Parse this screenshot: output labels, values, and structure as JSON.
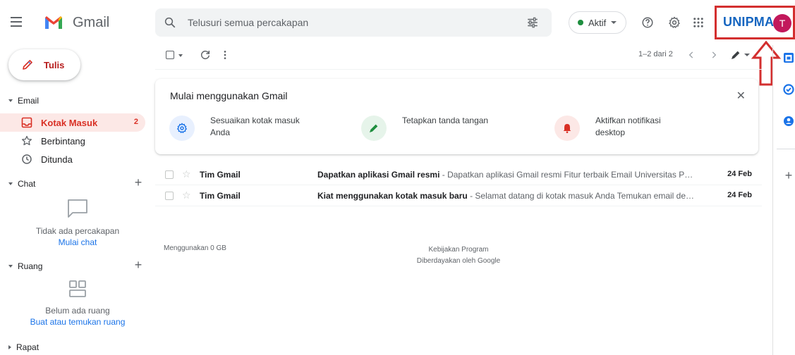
{
  "header": {
    "app_name": "Gmail",
    "search_placeholder": "Telusuri semua percakapan",
    "status_label": "Aktif",
    "brand_name": "UNIPMA",
    "avatar_initial": "T"
  },
  "compose": {
    "label": "Tulis"
  },
  "sidebar": {
    "email_section": "Email",
    "items": [
      {
        "label": "Kotak Masuk",
        "count": "2",
        "icon": "inbox-icon"
      },
      {
        "label": "Berbintang",
        "count": "",
        "icon": "star-icon"
      },
      {
        "label": "Ditunda",
        "count": "",
        "icon": "clock-icon"
      }
    ],
    "chat_section": "Chat",
    "chat_empty": "Tidak ada percakapan",
    "chat_link": "Mulai chat",
    "rooms_section": "Ruang",
    "rooms_empty": "Belum ada ruang",
    "rooms_link": "Buat atau temukan ruang",
    "meet_section": "Rapat"
  },
  "toolbar": {
    "pager": "1–2 dari 2"
  },
  "onboarding": {
    "title": "Mulai menggunakan Gmail",
    "items": [
      {
        "label": "Sesuaikan kotak masuk Anda",
        "icon": "gear-icon"
      },
      {
        "label": "Tetapkan tanda tangan",
        "icon": "pen-icon"
      },
      {
        "label": "Aktifkan notifikasi desktop",
        "icon": "bell-icon"
      }
    ]
  },
  "emails": [
    {
      "sender": "Tim Gmail",
      "subject": "Dapatkan aplikasi Gmail resmi",
      "snippet": " - Dapatkan aplikasi Gmail resmi Fitur terbaik Email Universitas PGRI ...",
      "date": "24 Feb"
    },
    {
      "sender": "Tim Gmail",
      "subject": "Kiat menggunakan kotak masuk baru",
      "snippet": " - Selamat datang di kotak masuk Anda Temukan email dengan...",
      "date": "24 Feb"
    }
  ],
  "footer": {
    "storage": "Menggunakan 0 GB",
    "policy": "Kebijakan Program",
    "powered": "Diberdayakan oleh Google"
  },
  "colors": {
    "accent_red": "#d93025",
    "active_bg": "#fce8e6",
    "link_blue": "#1a73e8",
    "brand_blue": "#1565c0",
    "annotation_red": "#d32f2f",
    "status_green": "#1e8e3e"
  }
}
